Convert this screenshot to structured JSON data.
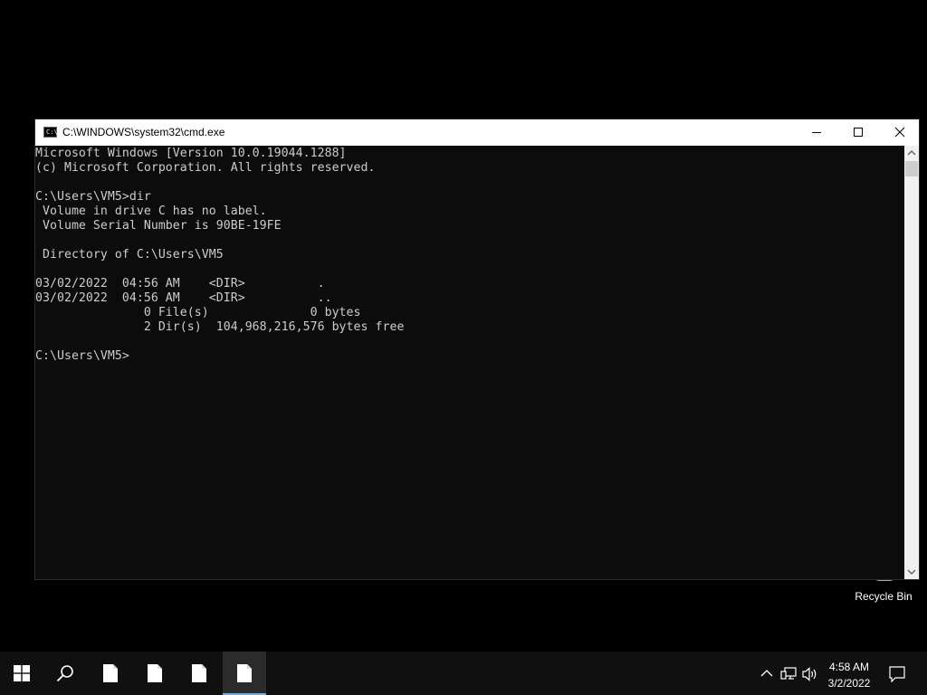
{
  "window": {
    "title": "C:\\WINDOWS\\system32\\cmd.exe",
    "icon_text": "C:\\"
  },
  "console": {
    "lines": [
      "Microsoft Windows [Version 10.0.19044.1288]",
      "(c) Microsoft Corporation. All rights reserved.",
      "",
      "C:\\Users\\VM5>dir",
      " Volume in drive C has no label.",
      " Volume Serial Number is 90BE-19FE",
      "",
      " Directory of C:\\Users\\VM5",
      "",
      "03/02/2022  04:56 AM    <DIR>          .",
      "03/02/2022  04:56 AM    <DIR>          ..",
      "               0 File(s)              0 bytes",
      "               2 Dir(s)  104,968,216,576 bytes free",
      "",
      "C:\\Users\\VM5>"
    ]
  },
  "desktop": {
    "recycle_bin_label": "Recycle Bin"
  },
  "taskbar": {
    "start_icon": "windows-logo-icon",
    "search_icon": "search-icon",
    "pinned": [
      "file-icon",
      "file-icon",
      "file-icon",
      "file-icon"
    ],
    "clock_time": "4:58 AM",
    "clock_date": "3/2/2022"
  },
  "colors": {
    "console_bg": "#0c0c0c",
    "console_text": "#cccccc",
    "taskbar_bg": "#101010",
    "active_underline": "#7aa7d6"
  }
}
